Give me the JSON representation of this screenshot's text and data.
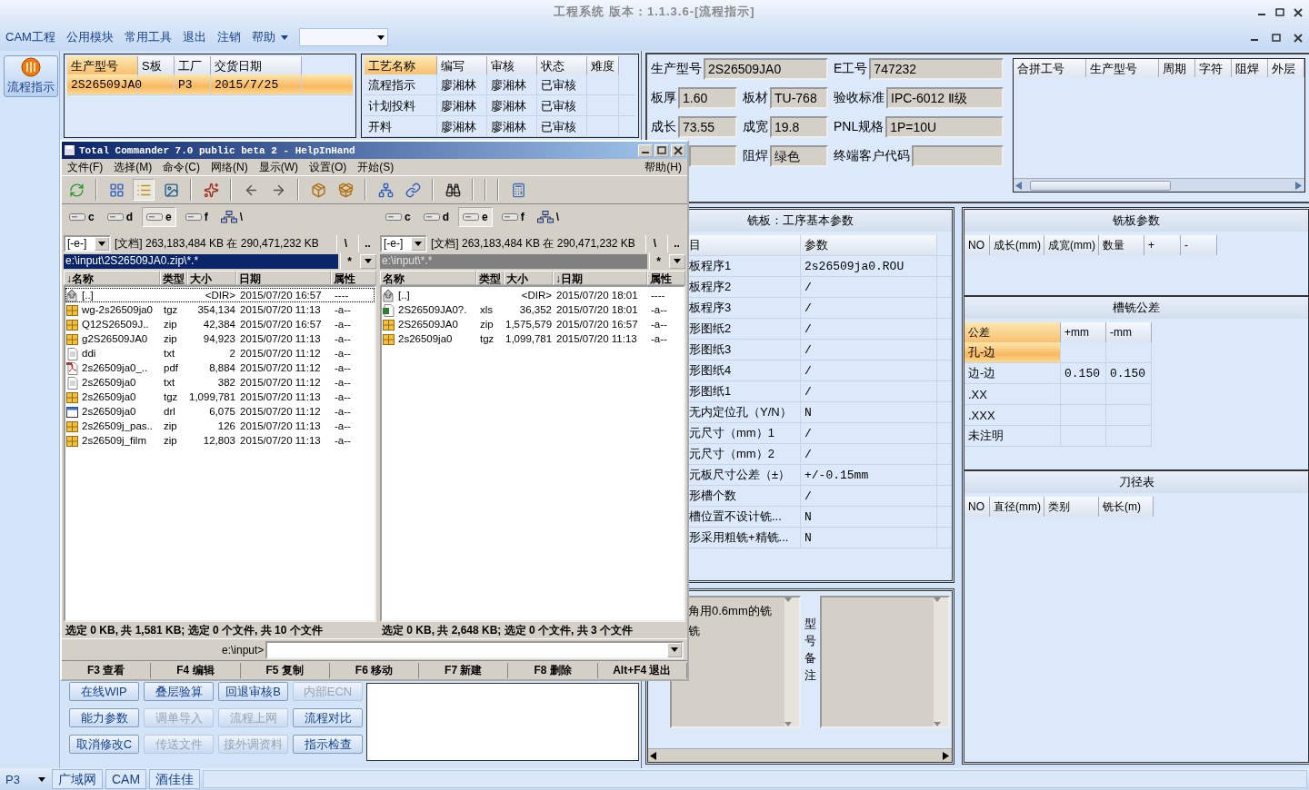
{
  "window": {
    "title": "工程系统 版本：1.1.3.6-[流程指示]"
  },
  "menu": {
    "items": [
      "CAM工程",
      "公用模块",
      "常用工具",
      "退出",
      "注销",
      "帮助"
    ]
  },
  "sidebar": {
    "items": [
      {
        "label": "流程指示",
        "selected": true
      }
    ]
  },
  "orders": {
    "columns": [
      "生产型号",
      "S板",
      "工厂",
      "交货日期"
    ],
    "rows": [
      {
        "model": "2S26509JA0",
        "factory": "P3",
        "date": "2015/7/25",
        "selected": true
      }
    ]
  },
  "process": {
    "columns": [
      "工艺名称",
      "编写",
      "审核",
      "状态",
      "难度"
    ],
    "rows": [
      {
        "name": "流程指示",
        "author": "廖湘林",
        "reviewer": "廖湘林",
        "status": "已审核"
      },
      {
        "name": "计划投料",
        "author": "廖湘林",
        "reviewer": "廖湘林",
        "status": "已审核"
      },
      {
        "name": "开料",
        "author": "廖湘林",
        "reviewer": "廖湘林",
        "status": "已审核"
      }
    ]
  },
  "buttons": [
    {
      "label": "在线WIP",
      "disabled": false
    },
    {
      "label": "叠层验算",
      "disabled": false
    },
    {
      "label": "回退审核B",
      "disabled": false
    },
    {
      "label": "内部ECN",
      "disabled": true
    },
    {
      "label": "能力参数",
      "disabled": false
    },
    {
      "label": "调单导入",
      "disabled": true
    },
    {
      "label": "流程上网",
      "disabled": true
    },
    {
      "label": "流程对比",
      "disabled": false
    },
    {
      "label": "取消修改C",
      "disabled": false
    },
    {
      "label": "传送文件",
      "disabled": true
    },
    {
      "label": "接外调资料",
      "disabled": true
    },
    {
      "label": "指示检查",
      "disabled": false
    }
  ],
  "info": {
    "fields": [
      {
        "kind": "labeled",
        "label": "生产型号",
        "value": "2S26509JA0"
      },
      {
        "kind": "labeled",
        "label": "E工号",
        "value": "747232"
      },
      {
        "kind": "labeled",
        "label": "板厚",
        "value": "1.60"
      },
      {
        "kind": "labeled",
        "label": "板材",
        "value": "TU-768"
      },
      {
        "kind": "labeled",
        "label": "验收标准",
        "value": "IPC-6012 Ⅱ级"
      },
      {
        "kind": "labeled",
        "label": "成长",
        "value": "73.55"
      },
      {
        "kind": "labeled",
        "label": "成宽",
        "value": "19.8"
      },
      {
        "kind": "labeled",
        "label": "PNL规格",
        "value": "1P=10U"
      },
      {
        "kind": "unlabeled"
      },
      {
        "kind": "labeled",
        "label": "阻焊",
        "value": "绿色"
      },
      {
        "kind": "labeled",
        "label": "终端客户代码"
      }
    ]
  },
  "merge_table": {
    "columns": [
      "合拼工号",
      "生产型号",
      "周期",
      "字符",
      "阻焊",
      "外层"
    ]
  },
  "params": {
    "title": "铣板：工序基本参数",
    "columns": [
      "目",
      "参数"
    ],
    "rows": [
      {
        "item": "板程序1",
        "value": "2s26509ja0.ROU"
      },
      {
        "item": "板程序2",
        "value": "/"
      },
      {
        "item": "板程序3",
        "value": "/"
      },
      {
        "item": "形图纸2",
        "value": "/"
      },
      {
        "item": "形图纸3",
        "value": "/"
      },
      {
        "item": "形图纸4",
        "value": "/"
      },
      {
        "item": "形图纸1",
        "value": "/"
      },
      {
        "item": "无内定位孔（Y/N）",
        "value": "N"
      },
      {
        "item": "元尺寸（mm）1",
        "value": "/"
      },
      {
        "item": "元尺寸（mm）2",
        "value": "/"
      },
      {
        "item": "元板尺寸公差（±）",
        "value": "+/-0.15mm"
      },
      {
        "item": "形槽个数",
        "value": "/"
      },
      {
        "item": "槽位置不设计铣...",
        "value": "N"
      },
      {
        "item": "形采用粗铣+精铣...",
        "value": "N"
      }
    ]
  },
  "notes": {
    "lines": [
      "角用0.6mm的铣",
      "铣"
    ],
    "label": "型号备注"
  },
  "mill_params": {
    "title": "铣板参数",
    "columns": [
      "NO",
      "成长(mm)",
      "成宽(mm)",
      "数量",
      "+",
      "-"
    ]
  },
  "tolerance": {
    "title": "槽铣公差",
    "columns": [
      "公差",
      "+mm",
      "-mm"
    ],
    "rows": [
      {
        "name": "孔-边",
        "selected": true
      },
      {
        "name": "边-边",
        "plus": "0.150",
        "minus": "0.150",
        "selected": false
      },
      {
        "name": ".XX",
        "selected": false
      },
      {
        "name": ".XXX",
        "selected": false
      },
      {
        "name": "未注明",
        "selected": false
      }
    ]
  },
  "tools": {
    "title": "刀径表",
    "columns": [
      "NO",
      "直径(mm)",
      "类别",
      "铣长(m)"
    ]
  },
  "status_bar": {
    "combo": "P3",
    "items": [
      "广域网",
      "CAM",
      "酒佳佳"
    ]
  },
  "commander": {
    "title": "Total Commander 7.0 public beta 2 - HelpInHand",
    "menu": [
      "文件(F)",
      "选择(M)",
      "命令(C)",
      "网络(N)",
      "显示(W)",
      "设置(O)",
      "开始(S)"
    ],
    "help": "帮助(H)",
    "panels": [
      {
        "active": true,
        "drives": [
          {
            "kind": "drive",
            "label": "c",
            "selected": false
          },
          {
            "kind": "drive",
            "label": "d",
            "selected": false
          },
          {
            "kind": "drive",
            "label": "e",
            "selected": true
          },
          {
            "kind": "drive",
            "label": "f",
            "selected": false
          },
          {
            "kind": "network",
            "label": "\\",
            "selected": false
          }
        ],
        "drive_combo": "[-e-]",
        "free_space": "[文档] 263,183,484 KB 在 290,471,232 KB",
        "root_button": "\\",
        "up_button": "..",
        "path": "e:\\input\\2S26509JA0.zip\\*.*",
        "filter": "*",
        "columns": [
          "↓名称",
          "类型",
          "大小",
          "日期",
          "属性"
        ],
        "files": [
          {
            "kind": "parent",
            "name": "[..]",
            "size": "<DIR>",
            "date": "2015/07/20 16:57",
            "attr": "----",
            "focused": true
          },
          {
            "kind": "archive",
            "name": "wg-2s26509ja0",
            "type": "tgz",
            "size": "354,134",
            "date": "2015/07/20 11:13",
            "attr": "-a--",
            "focused": false
          },
          {
            "kind": "archive",
            "name": "Q12S26509J..",
            "type": "zip",
            "size": "42,384",
            "date": "2015/07/20 16:57",
            "attr": "-a--",
            "focused": false
          },
          {
            "kind": "archive",
            "name": "g2S26509JA0",
            "type": "zip",
            "size": "94,923",
            "date": "2015/07/20 11:13",
            "attr": "-a--",
            "focused": false
          },
          {
            "kind": "document",
            "name": "ddi",
            "type": "txt",
            "size": "2",
            "date": "2015/07/20 11:12",
            "attr": "-a--",
            "focused": false
          },
          {
            "kind": "acrobat",
            "name": "2s26509ja0_..",
            "type": "pdf",
            "size": "8,884",
            "date": "2015/07/20 11:12",
            "attr": "-a--",
            "focused": false
          },
          {
            "kind": "document",
            "name": "2s26509ja0",
            "type": "txt",
            "size": "382",
            "date": "2015/07/20 11:12",
            "attr": "-a--",
            "focused": false
          },
          {
            "kind": "archive",
            "name": "2s26509ja0",
            "type": "tgz",
            "size": "1,099,781",
            "date": "2015/07/20 11:13",
            "attr": "-a--",
            "focused": false
          },
          {
            "kind": "program",
            "name": "2s26509ja0",
            "type": "drl",
            "size": "6,075",
            "date": "2015/07/20 11:12",
            "attr": "-a--",
            "focused": false
          },
          {
            "kind": "archive",
            "name": "2s26509j_pas..",
            "type": "zip",
            "size": "126",
            "date": "2015/07/20 11:13",
            "attr": "-a--",
            "focused": false
          },
          {
            "kind": "archive",
            "name": "2s26509j_film",
            "type": "zip",
            "size": "12,803",
            "date": "2015/07/20 11:13",
            "attr": "-a--",
            "focused": false
          }
        ],
        "status": "选定 0 KB, 共 1,581 KB; 选定 0 个文件, 共 10 个文件"
      },
      {
        "active": false,
        "drives": [
          {
            "kind": "drive",
            "label": "c",
            "selected": false
          },
          {
            "kind": "drive",
            "label": "d",
            "selected": false
          },
          {
            "kind": "drive",
            "label": "e",
            "selected": true
          },
          {
            "kind": "drive",
            "label": "f",
            "selected": false
          },
          {
            "kind": "network",
            "label": "\\",
            "selected": false
          }
        ],
        "drive_combo": "[-e-]",
        "free_space": "[文档] 263,183,484 KB 在 290,471,232 KB",
        "root_button": "\\",
        "up_button": "..",
        "path": "e:\\input\\*.*",
        "filter": "*",
        "columns": [
          "名称",
          "类型",
          "大小",
          "↓日期",
          "属性"
        ],
        "files": [
          {
            "kind": "parent",
            "name": "[..]",
            "size": "<DIR>",
            "date": "2015/07/20 18:01",
            "attr": "----",
            "focused": false
          },
          {
            "kind": "spreadsheet",
            "name": "2S26509JA0?.",
            "type": "xls",
            "size": "36,352",
            "date": "2015/07/20 18:01",
            "attr": "-a--",
            "focused": false
          },
          {
            "kind": "archive",
            "name": "2S26509JA0",
            "type": "zip",
            "size": "1,575,579",
            "date": "2015/07/20 16:57",
            "attr": "-a--",
            "focused": false
          },
          {
            "kind": "archive",
            "name": "2s26509ja0",
            "type": "tgz",
            "size": "1,099,781",
            "date": "2015/07/20 11:13",
            "attr": "-a--",
            "focused": false
          }
        ],
        "status": "选定 0 KB, 共 2,648 KB; 选定 0 个文件, 共 3 个文件"
      }
    ],
    "prompt": "e:\\input>",
    "fkeys": [
      "F3 查看",
      "F4 编辑",
      "F5 复制",
      "F6 移动",
      "F7 新建",
      "F8 删除",
      "Alt+F4 退出"
    ]
  }
}
